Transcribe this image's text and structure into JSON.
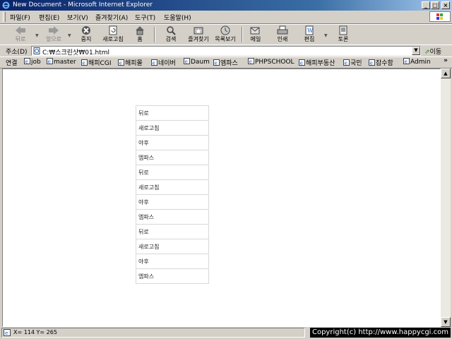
{
  "window": {
    "title": "New Document - Microsoft Internet Explorer",
    "controls": {
      "minimize": "_",
      "maximize": "□",
      "close": "×"
    }
  },
  "menu": {
    "items": [
      {
        "label": "파일(F)"
      },
      {
        "label": "편집(E)"
      },
      {
        "label": "보기(V)"
      },
      {
        "label": "즐겨찾기(A)"
      },
      {
        "label": "도구(T)"
      },
      {
        "label": "도움말(H)"
      }
    ]
  },
  "toolbar": {
    "back": "뒤로",
    "forward": "앞으로",
    "stop": "중지",
    "refresh": "새로고침",
    "home": "홈",
    "search": "검색",
    "favorites": "즐겨찾기",
    "history": "목록보기",
    "mail": "메일",
    "print": "인쇄",
    "edit": "편집",
    "discuss": "토론"
  },
  "address": {
    "label": "주소(D)",
    "url": "C:₩스크린샷₩01.html",
    "go": "이동"
  },
  "links": {
    "label": "연결",
    "items": [
      "job",
      "master",
      "해피CGI",
      "해피몰",
      "네이버",
      "Daum",
      "엠파스",
      "PHPSCHOOL",
      "해피부동산",
      "국민",
      "잡수함",
      "Admin"
    ],
    "more": "»"
  },
  "nav_items": [
    "뒤로",
    "새로고침",
    "야후",
    "엠파스",
    "뒤로",
    "새로고침",
    "야후",
    "엠파스",
    "뒤로",
    "새로고침",
    "야후",
    "엠파스"
  ],
  "status": {
    "text": "X= 114  Y= 265",
    "copyright": "Copyright(c) http://www.happycgi.com"
  },
  "scroll": {
    "up": "▲",
    "down": "▼"
  },
  "colors": {
    "titlebar": "#0a246a",
    "chrome": "#d4d0c8",
    "content": "#ffffff",
    "ie_blue": "#1c5ec8"
  }
}
